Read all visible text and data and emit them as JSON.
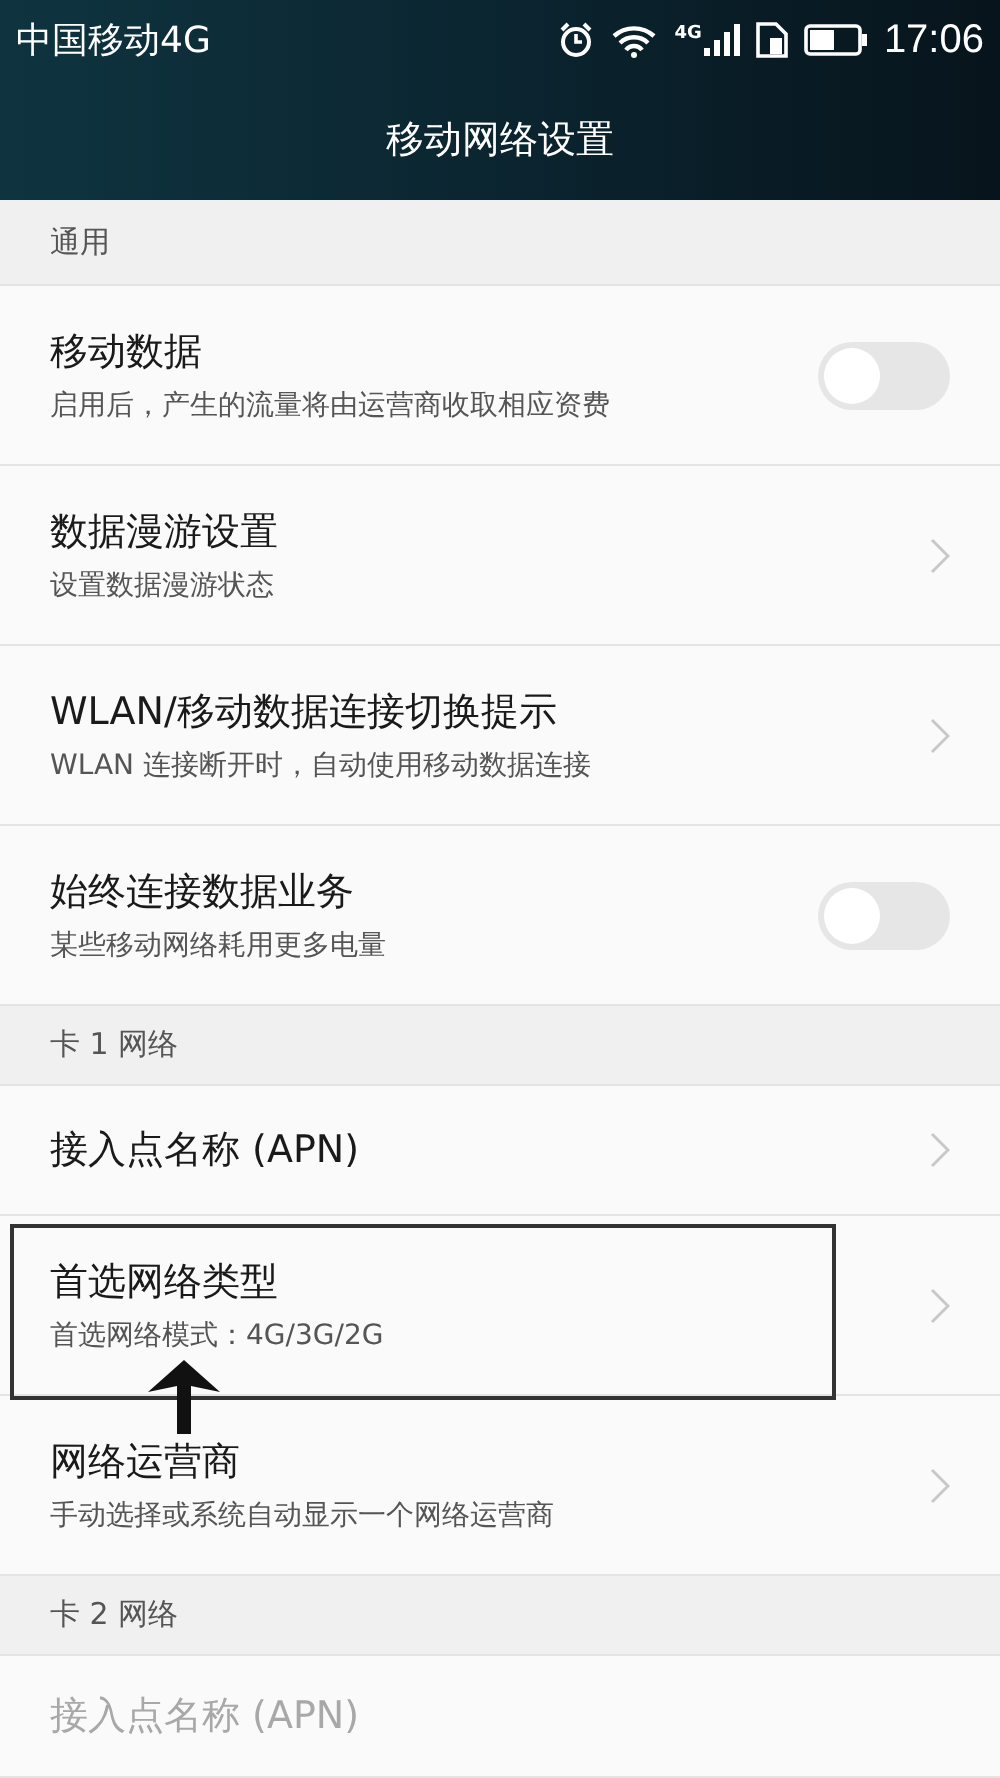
{
  "status_bar": {
    "carrier": "中国移动4G",
    "network_badge": "4G",
    "time": "17:06"
  },
  "title": "移动网络设置",
  "sections": [
    {
      "header": "通用",
      "items": [
        {
          "kind": "toggle",
          "title": "移动数据",
          "subtitle": "启用后，产生的流量将由运营商收取相应资费",
          "on": false
        },
        {
          "kind": "link",
          "title": "数据漫游设置",
          "subtitle": "设置数据漫游状态"
        },
        {
          "kind": "link",
          "title": "WLAN/移动数据连接切换提示",
          "subtitle": "WLAN 连接断开时，自动使用移动数据连接"
        },
        {
          "kind": "toggle",
          "title": "始终连接数据业务",
          "subtitle": "某些移动网络耗用更多电量",
          "on": false
        }
      ]
    },
    {
      "header": "卡 1 网络",
      "items": [
        {
          "kind": "link",
          "title": "接入点名称 (APN)"
        },
        {
          "kind": "link",
          "title": "首选网络类型",
          "subtitle": "首选网络模式：4G/3G/2G",
          "highlighted": true
        },
        {
          "kind": "link",
          "title": "网络运营商",
          "subtitle": "手动选择或系统自动显示一个网络运营商"
        }
      ]
    },
    {
      "header": "卡 2 网络",
      "items": [
        {
          "kind": "faded",
          "title": "接入点名称 (APN)"
        }
      ]
    }
  ]
}
